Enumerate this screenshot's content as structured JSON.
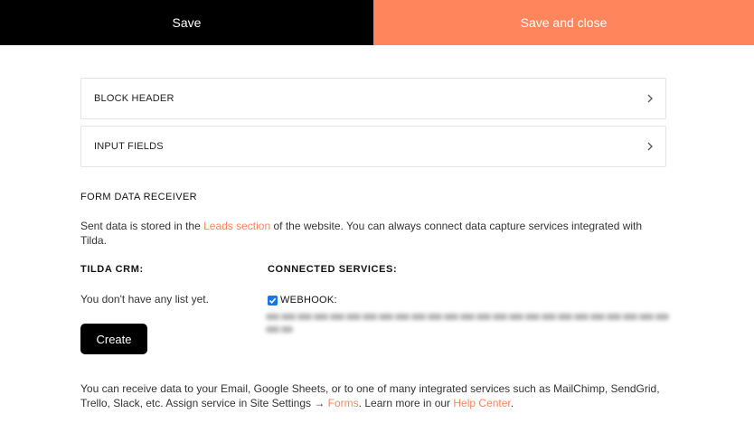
{
  "topbar": {
    "save_label": "Save",
    "save_close_label": "Save and close",
    "accent_color": "#ff855d"
  },
  "panels": [
    {
      "label": "BLOCK HEADER",
      "icon": "chevron-right-icon"
    },
    {
      "label": "INPUT FIELDS",
      "icon": "chevron-right-icon"
    }
  ],
  "form_receiver": {
    "title": "FORM DATA RECEIVER",
    "desc_before": "Sent data is stored in the ",
    "desc_link": "Leads section",
    "desc_after": " of the website. You can always connect data capture services integrated with Tilda."
  },
  "tilda_crm": {
    "heading": "TILDA CRM:",
    "empty_text": "You don't have any list yet.",
    "create_label": "Create"
  },
  "connected": {
    "heading": "CONNECTED SERVICES:",
    "webhook_label": "WEBHOOK:",
    "webhook_checked": true
  },
  "footer": {
    "text_before": "You can receive data to your Email, Google Sheets, or to one of many integrated services such as MailChimp, SendGrid, Trello, Slack, etc. Assign service in Site Settings → ",
    "forms_link": "Forms",
    "text_middle": ". Learn more in our ",
    "help_link": "Help Center",
    "text_end": "."
  }
}
